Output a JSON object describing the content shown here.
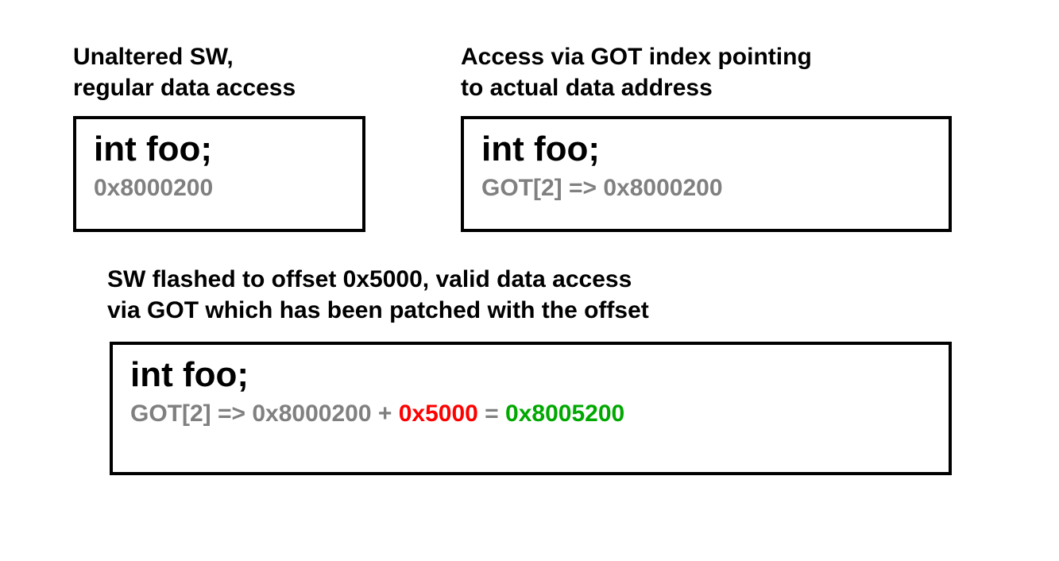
{
  "top_left": {
    "caption_line1": "Unaltered SW,",
    "caption_line2": "regular data access",
    "code": "int foo;",
    "addr": "0x8000200"
  },
  "top_right": {
    "caption_line1": "Access via GOT index pointing",
    "caption_line2": "to actual data address",
    "code": "int foo;",
    "addr": "GOT[2] => 0x8000200"
  },
  "bottom": {
    "caption_line1": "SW flashed to offset 0x5000, valid data access",
    "caption_line2": "via GOT which has been patched with the offset",
    "code": "int foo;",
    "seg_prefix": "GOT[2] => 0x8000200 + ",
    "seg_offset": "0x5000",
    "seg_equals": " = ",
    "seg_result": "0x8005200"
  }
}
